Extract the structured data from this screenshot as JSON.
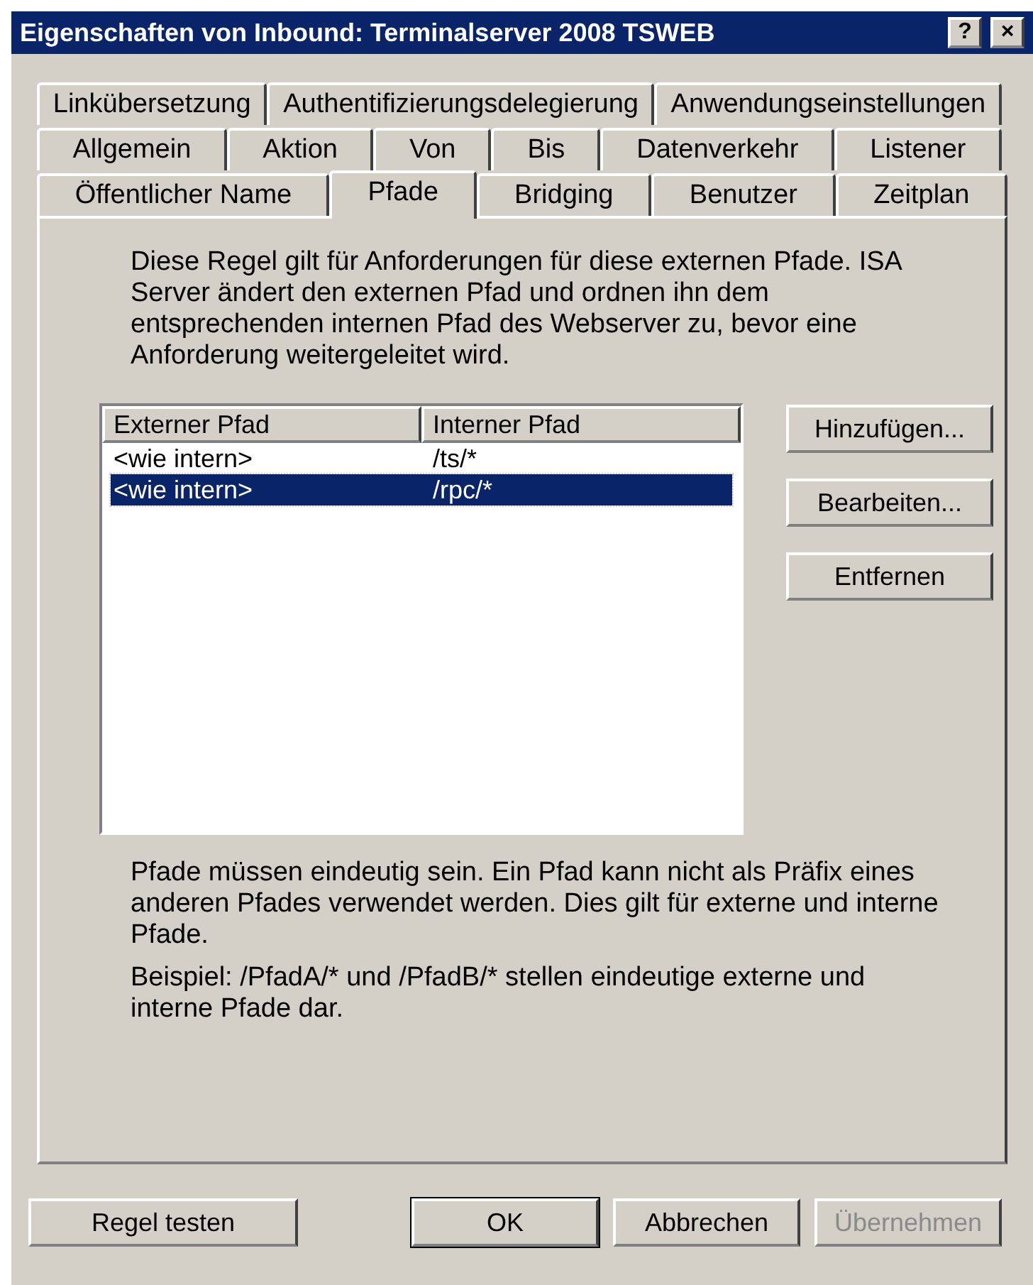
{
  "window": {
    "title": "Eigenschaften von Inbound: Terminalserver 2008 TSWEB",
    "title_buttons": [
      {
        "kind": "help",
        "label": "?"
      },
      {
        "kind": "close",
        "label": "×"
      }
    ]
  },
  "tab_rows": [
    [
      {
        "label": "Linkübersetzung",
        "selected": false
      },
      {
        "label": "Authentifizierungsdelegierung",
        "selected": false
      },
      {
        "label": "Anwendungseinstellungen",
        "selected": false
      }
    ],
    [
      {
        "label": "Allgemein",
        "selected": false
      },
      {
        "label": "Aktion",
        "selected": false
      },
      {
        "label": "Von",
        "selected": false
      },
      {
        "label": "Bis",
        "selected": false
      },
      {
        "label": "Datenverkehr",
        "selected": false
      },
      {
        "label": "Listener",
        "selected": false
      }
    ],
    [
      {
        "label": "Öffentlicher Name",
        "selected": false
      },
      {
        "label": "Pfade",
        "selected": true
      },
      {
        "label": "Bridging",
        "selected": false
      },
      {
        "label": "Benutzer",
        "selected": false
      },
      {
        "label": "Zeitplan",
        "selected": false
      }
    ]
  ],
  "description": "Diese Regel gilt für Anforderungen für diese externen Pfade. ISA Server ändert den externen Pfad und ordnen ihn dem entsprechenden internen Pfad des Webserver zu, bevor eine Anforderung weitergeleitet wird.",
  "table": {
    "columns": [
      "Externer Pfad",
      "Interner Pfad"
    ],
    "rows": [
      {
        "cells": [
          "<wie intern>",
          "/ts/*"
        ],
        "selected": false
      },
      {
        "cells": [
          "<wie intern>",
          "/rpc/*"
        ],
        "selected": true
      }
    ]
  },
  "side_buttons": [
    {
      "label": "Hinzufügen..."
    },
    {
      "label": "Bearbeiten..."
    },
    {
      "label": "Entfernen"
    }
  ],
  "note": "Pfade müssen eindeutig sein. Ein Pfad kann nicht als Präfix eines anderen Pfades verwendet werden. Dies gilt für externe und interne Pfade.",
  "example": "Beispiel: /PfadA/* und /PfadB/* stellen eindeutige externe und interne Pfade dar.",
  "buttons": [
    {
      "label": "Regel testen",
      "disabled": false,
      "default": false
    },
    {
      "label": "OK",
      "disabled": false,
      "default": true
    },
    {
      "label": "Abbrechen",
      "disabled": false,
      "default": false
    },
    {
      "label": "Übernehmen",
      "disabled": true,
      "default": false
    }
  ]
}
